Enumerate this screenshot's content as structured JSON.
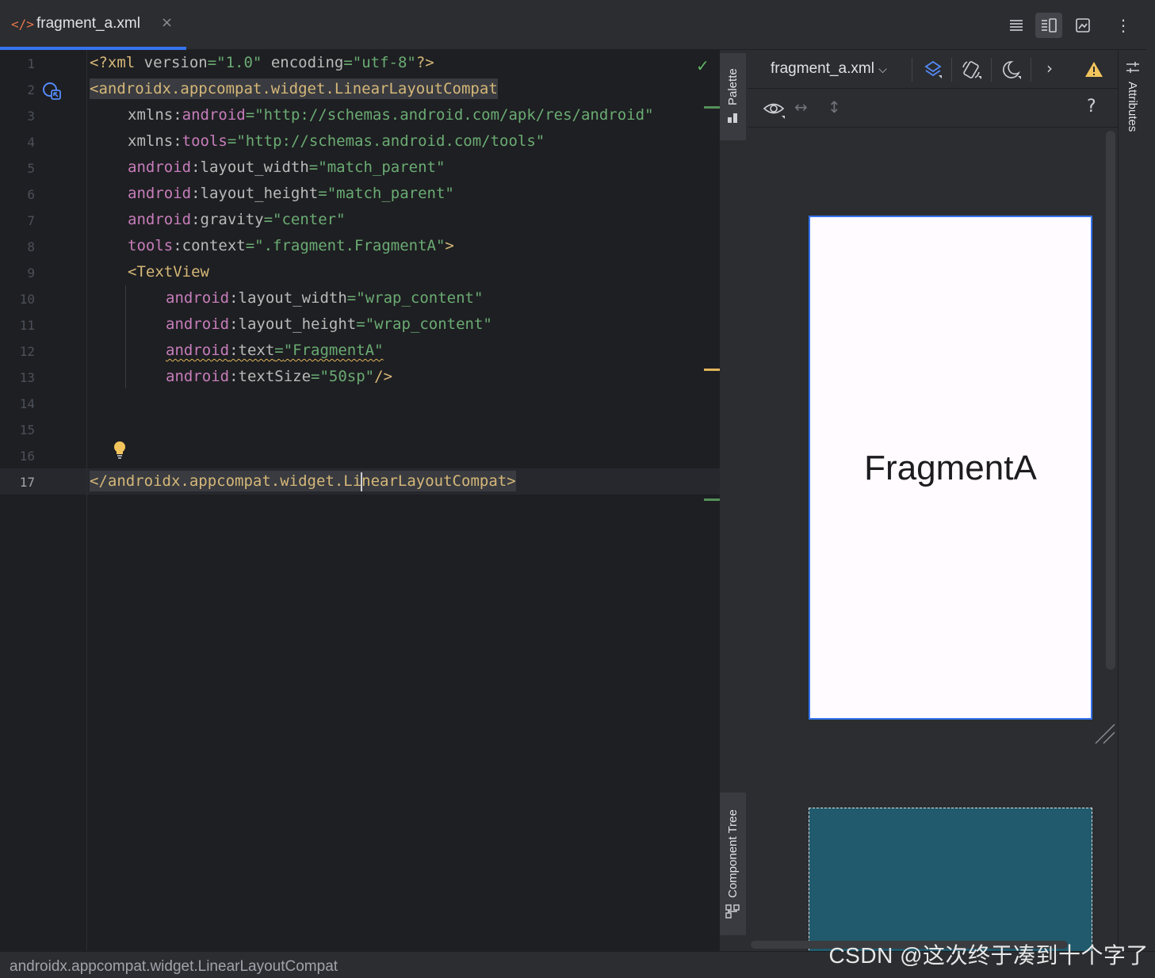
{
  "tab": {
    "icon": "</>",
    "title": "fragment_a.xml",
    "close": "×"
  },
  "toolbar": {
    "code_view": "code-view-icon",
    "split_view": "split-view-icon",
    "design_view": "design-view-icon",
    "more": "more-options-icon"
  },
  "editor": {
    "line_numbers": [
      "1",
      "2",
      "3",
      "4",
      "5",
      "6",
      "7",
      "8",
      "9",
      "10",
      "11",
      "12",
      "13",
      "14",
      "15",
      "16",
      "17"
    ],
    "current_line": "17",
    "lines": {
      "l1": {
        "a": "<?xml ",
        "b": "version",
        "c": "=",
        "d": "\"1.0\"",
        "e": " encoding",
        "f": "=",
        "g": "\"utf-8\"",
        "h": "?>"
      },
      "l2": {
        "a": "<androidx.appcompat.widget.LinearLayoutCompat"
      },
      "l3": {
        "a": "xmlns",
        "b": ":",
        "c": "android",
        "d": "=",
        "e": "\"http://schemas.android.com/apk/res/android\""
      },
      "l4": {
        "a": "xmlns",
        "b": ":",
        "c": "tools",
        "d": "=",
        "e": "\"http://schemas.android.com/tools\""
      },
      "l5": {
        "a": "android",
        "b": ":layout_width",
        "c": "=",
        "d": "\"match_parent\""
      },
      "l6": {
        "a": "android",
        "b": ":layout_height",
        "c": "=",
        "d": "\"match_parent\""
      },
      "l7": {
        "a": "android",
        "b": ":gravity",
        "c": "=",
        "d": "\"center\""
      },
      "l8": {
        "a": "tools",
        "b": ":context",
        "c": "=",
        "d": "\".fragment.FragmentA\"",
        "e": ">"
      },
      "l9": {
        "a": "<TextView"
      },
      "l10": {
        "a": "android",
        "b": ":layout_width",
        "c": "=",
        "d": "\"wrap_content\""
      },
      "l11": {
        "a": "android",
        "b": ":layout_height",
        "c": "=",
        "d": "\"wrap_content\""
      },
      "l12": {
        "a": "android",
        "b": ":text",
        "c": "=",
        "d": "\"FragmentA\""
      },
      "l13": {
        "a": "android",
        "b": ":textSize",
        "c": "=",
        "d": "\"50sp\"",
        "e": "/>"
      },
      "l17": {
        "a": "</androidx.appcompat.widget.Li",
        "b": "nearLayoutCompat",
        "c": ">"
      }
    }
  },
  "side_tabs": {
    "palette": "Palette",
    "component_tree": "Component Tree",
    "attributes": "Attributes"
  },
  "design": {
    "file_select": "fragment_a.xml",
    "chevron": "⌵",
    "help": "?",
    "preview_text": "FragmentA"
  },
  "status": {
    "breadcrumb": "androidx.appcompat.widget.LinearLayoutCompat"
  },
  "watermark": "CSDN @这次终于凑到十个字了",
  "colors": {
    "accent": "#3574f0",
    "tag": "#d5b778",
    "namespace": "#c77dbb",
    "string": "#6aab73",
    "blueprint": "#215a6d"
  }
}
